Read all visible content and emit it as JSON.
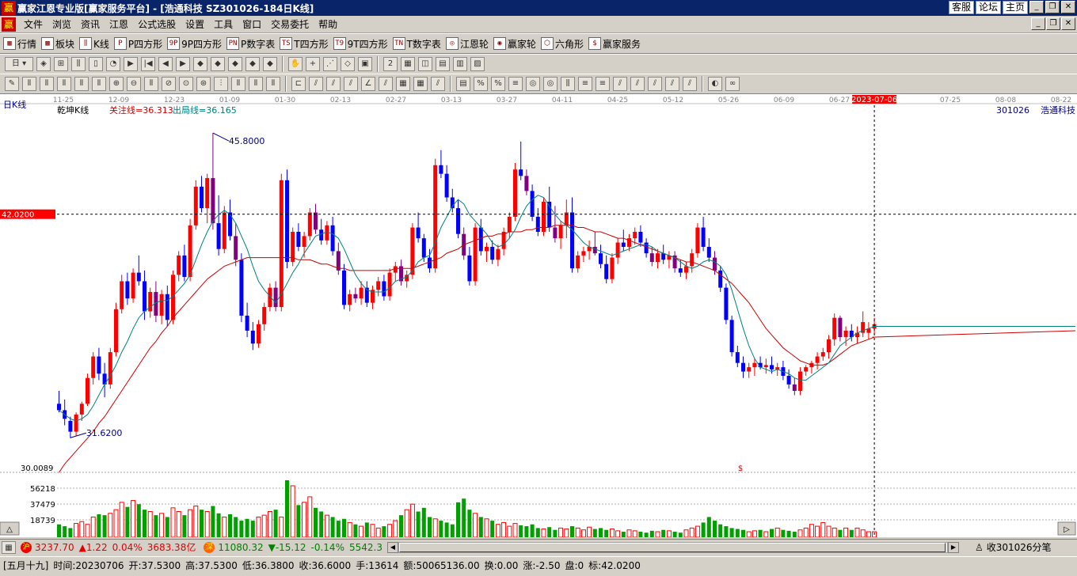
{
  "app": {
    "title": "赢家江恩专业版[赢家服务平台] - [浩通科技   SZ301026-184日K线]",
    "logo": "赢",
    "title_buttons": [
      "客服",
      "论坛",
      "主页"
    ]
  },
  "menu": [
    "文件",
    "浏览",
    "资讯",
    "江恩",
    "公式选股",
    "设置",
    "工具",
    "窗口",
    "交易委托",
    "帮助"
  ],
  "toolbar1": [
    {
      "label": "行情",
      "icon": "grid-icon"
    },
    {
      "label": "板块",
      "icon": "blocks-icon"
    },
    {
      "label": "K线",
      "icon": "candles-icon"
    },
    {
      "label": "P四方形",
      "icon": "P"
    },
    {
      "label": "9P四方形",
      "icon": "9P"
    },
    {
      "label": "P数字表",
      "icon": "PN"
    },
    {
      "label": "T四方形",
      "icon": "TS"
    },
    {
      "label": "9T四方形",
      "icon": "T9"
    },
    {
      "label": "T数字表",
      "icon": "TN"
    },
    {
      "label": "江恩轮",
      "icon": "wheel-icon"
    },
    {
      "label": "赢家轮",
      "icon": "wheel2-icon"
    },
    {
      "label": "六角形",
      "icon": "hexagon-icon"
    },
    {
      "label": "赢家服务",
      "icon": "dollar-icon"
    }
  ],
  "toolbar2_period": "日",
  "chart": {
    "period_label": "日K线",
    "indicator_name": "乾坤K线",
    "focus_line": "关注线=36.313",
    "exit_line": "出局线=36.165",
    "stock_code": "301026",
    "stock_name": "浩通科技",
    "high_label": "45.8000",
    "low_label": "31.6200",
    "cursor_price": "42.0200",
    "bottom_price": "30.0089",
    "cursor_date": "2023-07-06",
    "dollar_mark": "$",
    "date_ticks": [
      "11-25",
      "12-09",
      "12-23",
      "01-09",
      "01-30",
      "02-13",
      "02-27",
      "03-13",
      "03-27",
      "04-11",
      "04-25",
      "05-12",
      "05-26",
      "06-09",
      "06-27",
      "07-25",
      "08-08",
      "08-22"
    ],
    "volume_ticks": [
      "56218",
      "37479",
      "18739"
    ]
  },
  "chart_data": {
    "type": "candlestick",
    "ylim": [
      30.0089,
      46.5
    ],
    "candles": [
      [
        33.2,
        33.8,
        32.8,
        32.9
      ],
      [
        32.9,
        33.4,
        32.2,
        32.5
      ],
      [
        32.4,
        32.6,
        31.6,
        31.9
      ],
      [
        31.9,
        32.8,
        31.7,
        32.7
      ],
      [
        32.7,
        33.3,
        32.4,
        33.2
      ],
      [
        33.2,
        34.6,
        33.1,
        34.4
      ],
      [
        34.4,
        35.6,
        34.1,
        35.4
      ],
      [
        35.4,
        35.8,
        34.3,
        34.6
      ],
      [
        34.6,
        35.1,
        33.5,
        34.1
      ],
      [
        34.1,
        35.8,
        33.9,
        35.6
      ],
      [
        35.6,
        37.9,
        35.4,
        37.6
      ],
      [
        37.6,
        39.2,
        37.4,
        38.9
      ],
      [
        38.9,
        39.3,
        37.8,
        38.1
      ],
      [
        38.1,
        39.5,
        37.9,
        39.3
      ],
      [
        39.3,
        40.1,
        38.7,
        38.9
      ],
      [
        38.9,
        39.4,
        37.1,
        37.5
      ],
      [
        37.5,
        38.6,
        37.2,
        38.4
      ],
      [
        38.4,
        38.9,
        37.0,
        37.3
      ],
      [
        37.3,
        38.5,
        36.9,
        38.3
      ],
      [
        38.3,
        38.7,
        36.8,
        37.1
      ],
      [
        37.1,
        39.4,
        36.9,
        39.2
      ],
      [
        39.2,
        40.3,
        38.9,
        40.1
      ],
      [
        40.1,
        40.6,
        38.9,
        39.1
      ],
      [
        39.1,
        41.8,
        38.9,
        41.5
      ],
      [
        41.5,
        43.6,
        41.3,
        43.3
      ],
      [
        43.3,
        43.8,
        42.1,
        42.3
      ],
      [
        42.3,
        43.9,
        41.6,
        43.7
      ],
      [
        43.7,
        45.8,
        41.3,
        41.6
      ],
      [
        41.6,
        42.9,
        40.1,
        40.4
      ],
      [
        40.4,
        42.4,
        40.2,
        42.1
      ],
      [
        42.1,
        42.7,
        40.8,
        41.0
      ],
      [
        41.0,
        41.6,
        39.6,
        39.9
      ],
      [
        39.9,
        40.2,
        37.0,
        37.3
      ],
      [
        37.3,
        37.9,
        36.3,
        36.6
      ],
      [
        36.6,
        37.0,
        35.7,
        36.0
      ],
      [
        36.0,
        37.1,
        35.8,
        36.9
      ],
      [
        36.9,
        37.9,
        36.6,
        37.7
      ],
      [
        37.7,
        38.8,
        37.5,
        38.6
      ],
      [
        38.6,
        38.9,
        37.5,
        37.7
      ],
      [
        37.7,
        43.9,
        37.5,
        43.6
      ],
      [
        43.6,
        44.1,
        39.5,
        39.8
      ],
      [
        39.8,
        41.4,
        39.6,
        41.2
      ],
      [
        41.2,
        41.6,
        40.3,
        40.5
      ],
      [
        40.5,
        41.2,
        40.0,
        41.0
      ],
      [
        41.0,
        42.3,
        40.8,
        42.1
      ],
      [
        42.1,
        42.5,
        41.1,
        41.3
      ],
      [
        41.3,
        41.8,
        40.6,
        40.8
      ],
      [
        40.8,
        41.7,
        40.6,
        41.5
      ],
      [
        41.5,
        41.9,
        40.1,
        40.3
      ],
      [
        40.3,
        40.7,
        39.2,
        39.4
      ],
      [
        39.4,
        39.7,
        37.6,
        37.8
      ],
      [
        37.8,
        38.5,
        37.5,
        38.3
      ],
      [
        38.3,
        38.6,
        37.9,
        38.1
      ],
      [
        38.1,
        38.9,
        37.8,
        38.6
      ],
      [
        38.6,
        38.9,
        37.7,
        37.9
      ],
      [
        37.9,
        38.7,
        37.6,
        38.5
      ],
      [
        38.5,
        39.1,
        38.2,
        38.9
      ],
      [
        38.9,
        39.2,
        38.0,
        38.2
      ],
      [
        38.2,
        39.5,
        38.0,
        39.3
      ],
      [
        39.3,
        39.8,
        38.9,
        39.6
      ],
      [
        39.6,
        39.9,
        38.7,
        38.9
      ],
      [
        38.9,
        39.4,
        38.6,
        39.2
      ],
      [
        39.2,
        41.6,
        39.0,
        41.4
      ],
      [
        41.4,
        42.1,
        40.7,
        40.9
      ],
      [
        40.9,
        41.1,
        39.8,
        40.0
      ],
      [
        40.0,
        40.4,
        39.3,
        39.5
      ],
      [
        39.5,
        44.6,
        39.3,
        44.3
      ],
      [
        44.3,
        45.0,
        43.7,
        43.9
      ],
      [
        43.9,
        44.3,
        42.6,
        42.8
      ],
      [
        42.8,
        43.2,
        42.1,
        42.3
      ],
      [
        42.3,
        42.7,
        40.9,
        41.1
      ],
      [
        41.1,
        41.4,
        39.9,
        40.1
      ],
      [
        40.1,
        40.5,
        38.7,
        38.9
      ],
      [
        38.9,
        41.6,
        38.7,
        41.4
      ],
      [
        41.4,
        41.8,
        40.1,
        40.3
      ],
      [
        40.3,
        40.7,
        39.8,
        40.5
      ],
      [
        40.5,
        40.8,
        39.7,
        39.9
      ],
      [
        39.9,
        40.6,
        39.6,
        40.4
      ],
      [
        40.4,
        41.4,
        40.1,
        41.2
      ],
      [
        41.2,
        42.1,
        40.9,
        41.9
      ],
      [
        41.9,
        44.4,
        41.7,
        44.1
      ],
      [
        44.1,
        45.4,
        43.6,
        43.8
      ],
      [
        43.8,
        44.1,
        42.9,
        43.1
      ],
      [
        43.1,
        43.4,
        41.7,
        41.9
      ],
      [
        41.9,
        42.3,
        41.0,
        41.2
      ],
      [
        41.2,
        42.8,
        41.0,
        42.6
      ],
      [
        42.6,
        43.3,
        41.2,
        41.4
      ],
      [
        41.4,
        42.4,
        40.7,
        40.9
      ],
      [
        40.9,
        41.7,
        40.4,
        41.5
      ],
      [
        41.5,
        42.7,
        40.9,
        42.1
      ],
      [
        42.1,
        42.8,
        39.3,
        39.5
      ],
      [
        39.5,
        40.3,
        39.3,
        40.1
      ],
      [
        40.1,
        40.5,
        39.8,
        40.3
      ],
      [
        40.3,
        40.8,
        39.9,
        40.5
      ],
      [
        40.5,
        41.2,
        40.1,
        40.2
      ],
      [
        40.2,
        40.6,
        39.5,
        39.7
      ],
      [
        39.7,
        40.1,
        38.8,
        39.0
      ],
      [
        39.0,
        40.2,
        38.8,
        40.0
      ],
      [
        40.0,
        40.9,
        39.7,
        40.7
      ],
      [
        40.7,
        41.3,
        40.3,
        40.5
      ],
      [
        40.5,
        41.1,
        40.3,
        40.9
      ],
      [
        40.9,
        41.4,
        40.6,
        41.2
      ],
      [
        41.2,
        41.5,
        40.5,
        40.7
      ],
      [
        40.7,
        40.9,
        40.0,
        40.2
      ],
      [
        40.2,
        40.5,
        39.6,
        39.8
      ],
      [
        39.8,
        40.4,
        39.5,
        40.2
      ],
      [
        40.2,
        40.6,
        39.7,
        39.9
      ],
      [
        39.9,
        40.3,
        39.5,
        40.1
      ],
      [
        40.1,
        40.3,
        39.3,
        39.5
      ],
      [
        39.5,
        39.9,
        39.1,
        39.3
      ],
      [
        39.3,
        39.8,
        39.0,
        39.6
      ],
      [
        39.6,
        40.4,
        39.3,
        40.2
      ],
      [
        40.2,
        41.6,
        40.0,
        41.4
      ],
      [
        41.4,
        41.9,
        40.3,
        40.5
      ],
      [
        40.5,
        40.9,
        39.8,
        40.0
      ],
      [
        40.0,
        40.3,
        39.2,
        39.4
      ],
      [
        39.4,
        39.6,
        38.4,
        38.6
      ],
      [
        38.6,
        38.8,
        36.9,
        37.1
      ],
      [
        37.1,
        37.3,
        35.4,
        35.6
      ],
      [
        35.6,
        35.9,
        34.9,
        35.1
      ],
      [
        35.1,
        35.4,
        34.4,
        34.7
      ],
      [
        34.7,
        35.1,
        34.4,
        34.9
      ],
      [
        34.9,
        35.3,
        34.5,
        35.1
      ],
      [
        35.1,
        35.4,
        34.8,
        34.9
      ],
      [
        34.9,
        35.3,
        34.6,
        35.0
      ],
      [
        35.0,
        35.4,
        34.6,
        34.8
      ],
      [
        34.8,
        35.1,
        34.5,
        34.9
      ],
      [
        34.9,
        35.2,
        34.3,
        34.5
      ],
      [
        34.5,
        34.8,
        33.9,
        34.1
      ],
      [
        34.1,
        34.4,
        33.6,
        33.8
      ],
      [
        33.8,
        34.9,
        33.6,
        34.7
      ],
      [
        34.7,
        35.0,
        34.5,
        34.9
      ],
      [
        34.9,
        35.2,
        34.6,
        35.1
      ],
      [
        35.1,
        35.6,
        34.8,
        35.4
      ],
      [
        35.4,
        35.8,
        35.2,
        35.6
      ],
      [
        35.6,
        36.4,
        35.3,
        36.2
      ],
      [
        36.2,
        37.4,
        35.9,
        37.2
      ],
      [
        37.2,
        37.3,
        36.1,
        36.3
      ],
      [
        36.3,
        36.8,
        35.9,
        36.6
      ],
      [
        36.6,
        36.9,
        36.1,
        36.3
      ],
      [
        36.3,
        36.8,
        36.0,
        36.5
      ],
      [
        36.5,
        37.5,
        36.3,
        37.0
      ],
      [
        36.5,
        37.0,
        36.2,
        36.7
      ],
      [
        36.7,
        37.2,
        36.4,
        36.9
      ]
    ],
    "ma_fast": [
      32.9,
      32.7,
      32.5,
      32.4,
      32.5,
      32.7,
      33.1,
      33.6,
      34.1,
      34.5,
      35.0,
      35.6,
      36.1,
      36.7,
      37.2,
      37.5,
      37.7,
      37.9,
      38.0,
      38.0,
      38.2,
      38.5,
      38.8,
      39.2,
      39.9,
      40.6,
      41.2,
      41.7,
      42.0,
      42.2,
      42.0,
      41.6,
      41.0,
      40.4,
      39.6,
      38.9,
      38.5,
      38.2,
      37.9,
      38.3,
      38.8,
      39.3,
      39.7,
      40.2,
      40.6,
      41.0,
      41.1,
      41.2,
      41.1,
      40.9,
      40.4,
      39.8,
      39.2,
      38.8,
      38.5,
      38.4,
      38.4,
      38.4,
      38.6,
      38.9,
      39.0,
      39.1,
      39.4,
      39.8,
      40.0,
      40.1,
      40.7,
      41.4,
      41.9,
      42.4,
      42.7,
      42.5,
      42.0,
      41.7,
      41.4,
      41.1,
      40.7,
      40.5,
      40.6,
      40.9,
      41.3,
      41.9,
      42.4,
      42.7,
      42.9,
      42.8,
      42.4,
      42.0,
      41.7,
      41.5,
      41.3,
      41.0,
      40.7,
      40.5,
      40.4,
      40.3,
      40.2,
      40.1,
      40.2,
      40.3,
      40.4,
      40.5,
      40.6,
      40.6,
      40.5,
      40.3,
      40.2,
      40.1,
      40.0,
      39.8,
      39.6,
      39.5,
      39.6,
      39.8,
      39.9,
      39.8,
      39.6,
      39.2,
      38.5,
      37.6,
      36.7,
      35.9,
      35.3,
      34.9,
      34.8,
      34.7,
      34.8,
      34.7,
      34.6,
      34.4,
      34.3,
      34.3,
      34.5,
      34.7,
      34.9,
      35.1,
      35.5,
      35.9,
      36.1,
      36.3,
      36.5,
      36.6,
      36.7,
      36.8
    ],
    "ma_slow": [
      30.0,
      30.4,
      30.7,
      31.0,
      31.3,
      31.6,
      31.9,
      32.3,
      32.6,
      33.0,
      33.4,
      33.8,
      34.2,
      34.6,
      35.0,
      35.4,
      35.8,
      36.1,
      36.5,
      36.8,
      37.2,
      37.5,
      37.8,
      38.1,
      38.4,
      38.7,
      39.0,
      39.2,
      39.4,
      39.6,
      39.7,
      39.8,
      39.9,
      40.0,
      40.0,
      40.0,
      40.0,
      40.0,
      40.0,
      40.0,
      40.0,
      40.0,
      39.9,
      39.9,
      39.9,
      39.8,
      39.7,
      39.7,
      39.6,
      39.5,
      39.5,
      39.4,
      39.4,
      39.4,
      39.4,
      39.4,
      39.4,
      39.4,
      39.4,
      39.5,
      39.5,
      39.5,
      39.5,
      39.6,
      39.7,
      39.8,
      39.9,
      40.0,
      40.2,
      40.3,
      40.4,
      40.6,
      40.7,
      40.8,
      40.9,
      41.0,
      41.0,
      41.1,
      41.1,
      41.2,
      41.2,
      41.2,
      41.3,
      41.3,
      41.4,
      41.4,
      41.4,
      41.5,
      41.5,
      41.5,
      41.5,
      41.4,
      41.4,
      41.3,
      41.2,
      41.2,
      41.1,
      41.0,
      40.9,
      40.9,
      40.8,
      40.7,
      40.6,
      40.5,
      40.4,
      40.3,
      40.2,
      40.1,
      40.0,
      39.9,
      39.8,
      39.8,
      39.7,
      39.6,
      39.5,
      39.4,
      39.2,
      39.0,
      38.8,
      38.5,
      38.2,
      37.9,
      37.5,
      37.1,
      36.7,
      36.4,
      36.1,
      35.8,
      35.6,
      35.4,
      35.2,
      35.1,
      35.0,
      35.0,
      35.0,
      35.1,
      35.3,
      35.5,
      35.7,
      35.9,
      36.0,
      36.1,
      36.2,
      36.3
    ],
    "volume": [
      14,
      12,
      10,
      15,
      17,
      14,
      22,
      25,
      24,
      26,
      30,
      38,
      33,
      40,
      36,
      30,
      28,
      24,
      26,
      22,
      32,
      28,
      24,
      30,
      34,
      30,
      28,
      34,
      26,
      22,
      25,
      22,
      18,
      20,
      18,
      22,
      24,
      28,
      30,
      22,
      62,
      56,
      35,
      38,
      44,
      32,
      28,
      24,
      22,
      18,
      20,
      16,
      14,
      12,
      16,
      14,
      10,
      12,
      14,
      18,
      24,
      30,
      36,
      28,
      32,
      22,
      20,
      18,
      16,
      14,
      38,
      42,
      30,
      26,
      22,
      20,
      18,
      14,
      16,
      12,
      15,
      13,
      12,
      14,
      10,
      9,
      11,
      8,
      10,
      9,
      12,
      10,
      8,
      11,
      9,
      10,
      8,
      9,
      7,
      6,
      8,
      7,
      6,
      5,
      7,
      6,
      8,
      7,
      6,
      5,
      8,
      10,
      12,
      16,
      22,
      18,
      14,
      12,
      10,
      9,
      8,
      6,
      7,
      8,
      6,
      9,
      10,
      8,
      7,
      6,
      8,
      10,
      14,
      12,
      16,
      12,
      10,
      8,
      10,
      8,
      10,
      8,
      6,
      6
    ]
  },
  "status": {
    "sh_index": "3237.70",
    "sh_change": "▲1.22",
    "sh_pct": "0.04%",
    "sh_amount": "3683.38亿",
    "sz_index": "11080.32",
    "sz_change": "▼-15.12",
    "sz_pct": "-0.14%",
    "sz_amount": "5542.3",
    "tick_label": "收301026分笔"
  },
  "info": {
    "lunar": "[五月十九]",
    "time": "时间:20230706",
    "open": "开:37.5300",
    "high": "高:37.5300",
    "low": "低:36.3800",
    "close": "收:36.6000",
    "hands": "手:13614",
    "amount": "额:50065136.00",
    "turnover": "换:0.00",
    "change": "涨:-2.50",
    "pan": "盘:0",
    "mark": "标:42.0200"
  },
  "colors": {
    "up": "#ff0000",
    "down": "#0000ff",
    "purple": "#800080",
    "vol_up": "#ff0000",
    "vol_down": "#00a000",
    "ma_fast": "#008080",
    "ma_slow": "#cc0000"
  }
}
